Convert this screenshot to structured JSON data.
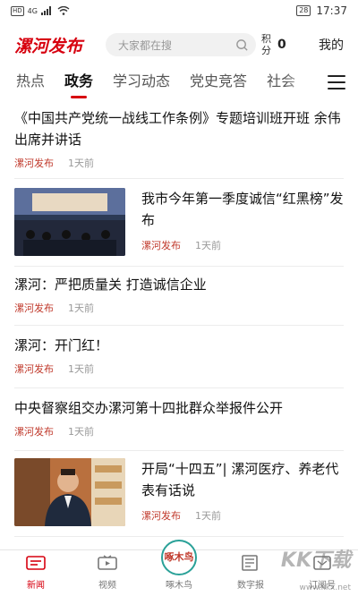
{
  "status_bar": {
    "hd": "HD",
    "network": "4G",
    "battery": "28",
    "time": "17:37"
  },
  "header": {
    "logo": "漯河发布",
    "search_placeholder": "大家都在搜",
    "points_label": "积分",
    "points_value": "0",
    "mine_label": "我的"
  },
  "tabs": [
    {
      "label": "热点"
    },
    {
      "label": "政务"
    },
    {
      "label": "学习动态"
    },
    {
      "label": "党史竞答"
    },
    {
      "label": "社会"
    }
  ],
  "active_tab": "政务",
  "articles": [
    {
      "title": "《中国共产党统一战线工作条例》专题培训班开班 余伟出席并讲话",
      "source": "漯河发布",
      "time": "1天前",
      "has_image": false
    },
    {
      "title": "我市今年第一季度诚信“红黑榜”发布",
      "source": "漯河发布",
      "time": "1天前",
      "has_image": true,
      "image": "meeting-photo"
    },
    {
      "title": "漯河：严把质量关 打造诚信企业",
      "source": "漯河发布",
      "time": "1天前",
      "has_image": false
    },
    {
      "title": "漯河：开门红！",
      "source": "漯河发布",
      "time": "1天前",
      "has_image": false
    },
    {
      "title": "中央督察组交办漯河第十四批群众举报件公开",
      "source": "漯河发布",
      "time": "1天前",
      "has_image": false
    },
    {
      "title": "开局“十四五”| 漯河医疗、养老代表有话说",
      "source": "漯河发布",
      "time": "1天前",
      "has_image": true,
      "image": "portrait-photo"
    }
  ],
  "bottom_nav": [
    {
      "label": "新闻",
      "icon": "news-icon",
      "active": true
    },
    {
      "label": "视频",
      "icon": "video-icon",
      "active": false
    },
    {
      "label": "啄木鸟",
      "icon": "woodpecker-icon",
      "active": false,
      "badge_text": "啄木鸟"
    },
    {
      "label": "数字报",
      "icon": "newspaper-icon",
      "active": false
    },
    {
      "label": "订阅号",
      "icon": "subscribe-icon",
      "active": false
    }
  ],
  "watermark": {
    "text": "KK下载",
    "url": "www.kkx.net"
  },
  "colors": {
    "brand": "#d7000f",
    "source": "#c0392b",
    "muted": "#999999"
  }
}
